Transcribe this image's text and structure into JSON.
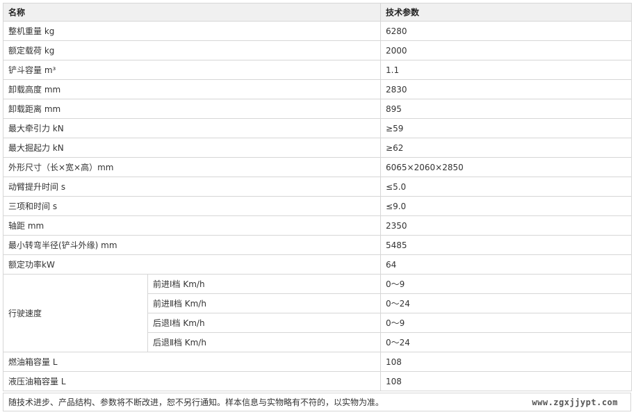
{
  "header": {
    "name": "名称",
    "value": "技术参数"
  },
  "rows": [
    {
      "label": "整机重量 kg",
      "value": "6280"
    },
    {
      "label": "额定载荷 kg",
      "value": "2000"
    },
    {
      "label": "铲斗容量 m³",
      "value": "1.1"
    },
    {
      "label": "卸载高度 mm",
      "value": "2830"
    },
    {
      "label": "卸载距离 mm",
      "value": "895"
    },
    {
      "label": "最大牵引力 kN",
      "value": "≥59"
    },
    {
      "label": "最大掘起力 kN",
      "value": "≥62"
    },
    {
      "label": "外形尺寸（长×宽×高）mm",
      "value": "6065×2060×2850"
    },
    {
      "label": "动臂提升时间 s",
      "value": "≤5.0"
    },
    {
      "label": "三项和时间 s",
      "value": "≤9.0"
    },
    {
      "label": "轴距 mm",
      "value": "2350"
    },
    {
      "label": "最小转弯半径(铲斗外缘) mm",
      "value": "5485"
    },
    {
      "label": "额定功率kW",
      "value": "64"
    }
  ],
  "travel_speed": {
    "label": "行驶速度",
    "sub": [
      {
        "label": "前进Ⅰ档 Km/h",
        "value": "0～9"
      },
      {
        "label": "前进Ⅱ档 Km/h",
        "value": "0～24"
      },
      {
        "label": "后退Ⅰ档 Km/h",
        "value": "0～9"
      },
      {
        "label": "后退Ⅱ档 Km/h",
        "value": "0～24"
      }
    ]
  },
  "tail_rows": [
    {
      "label": "燃油箱容量 L",
      "value": "108"
    },
    {
      "label": "液压油箱容量 L",
      "value": "108"
    }
  ],
  "footer": {
    "note": "随技术进步、产品结构、参数将不断改进，恕不另行通知。样本信息与实物略有不符的，以实物为准。",
    "watermark": "www.zgxjjypt.com"
  }
}
